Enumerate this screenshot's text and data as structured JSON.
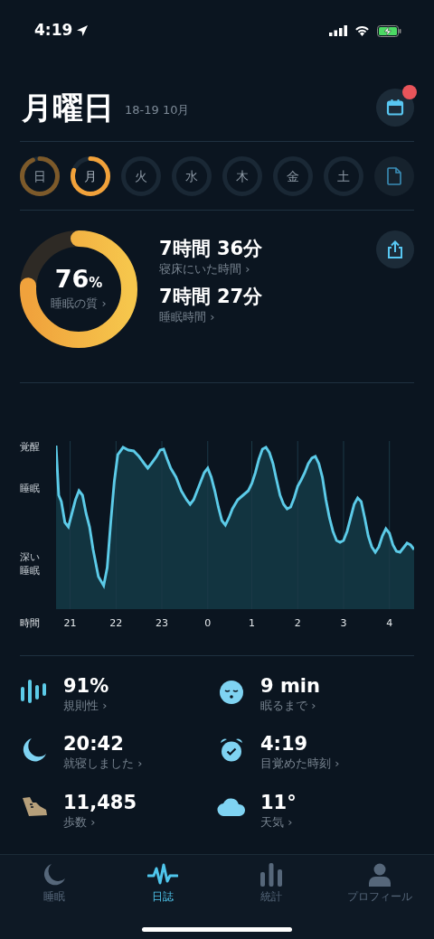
{
  "status_bar": {
    "time": "4:19"
  },
  "header": {
    "title": "月曜日",
    "date_range": "18-19 10月",
    "calendar_badge": true
  },
  "days": [
    {
      "kind": "day",
      "label": "日",
      "has_data": true,
      "selected": false
    },
    {
      "kind": "day",
      "label": "月",
      "has_data": true,
      "selected": true
    },
    {
      "kind": "day",
      "label": "火",
      "has_data": false,
      "selected": false
    },
    {
      "kind": "day",
      "label": "水",
      "has_data": false,
      "selected": false
    },
    {
      "kind": "day",
      "label": "木",
      "has_data": false,
      "selected": false
    },
    {
      "kind": "day",
      "label": "金",
      "has_data": false,
      "selected": false
    },
    {
      "kind": "day",
      "label": "土",
      "has_data": false,
      "selected": false
    },
    {
      "kind": "report"
    }
  ],
  "summary": {
    "quality": {
      "value": "76",
      "unit": "%",
      "label": "睡眠の質 ›",
      "level": 0.76
    },
    "metrics": [
      {
        "value": "7時間 36分",
        "label": "寝床にいた時間 ›"
      },
      {
        "value": "7時間 27分",
        "label": "睡眠時間 ›"
      }
    ]
  },
  "hypnogram": {
    "y_labels": [
      "覚醒",
      "睡眠",
      "深い睡眠"
    ],
    "x_title": "時間",
    "x_labels": [
      "21",
      "22",
      "23",
      "0",
      "1",
      "2",
      "3",
      "4"
    ]
  },
  "stats": [
    {
      "kind": "regularity",
      "value": "91%",
      "label": "規則性 ›"
    },
    {
      "kind": "fall-asleep",
      "value": "9 min",
      "label": "眠るまで ›"
    },
    {
      "kind": "bedtime",
      "value": "20:42",
      "label": "就寝しました ›"
    },
    {
      "kind": "wake",
      "value": "4:19",
      "label": "目覚めた時刻 ›"
    },
    {
      "kind": "steps",
      "value": "11,485",
      "label": "歩数 ›"
    },
    {
      "kind": "weather",
      "value": "11°",
      "label": "天気 ›"
    }
  ],
  "tabs": [
    {
      "kind": "sleep",
      "label": "睡眠",
      "selected": false
    },
    {
      "kind": "journal",
      "label": "日誌",
      "selected": true
    },
    {
      "kind": "stats",
      "label": "統計",
      "selected": false
    },
    {
      "kind": "profile",
      "label": "プロフィール",
      "selected": false
    }
  ]
}
